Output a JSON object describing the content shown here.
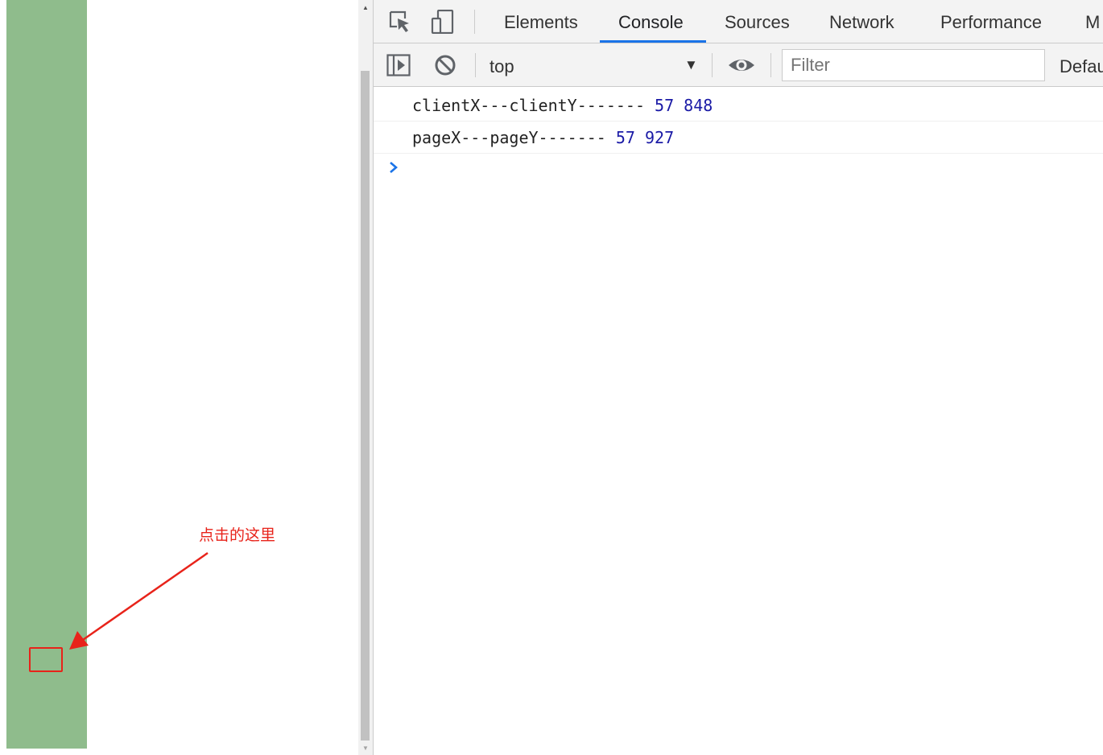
{
  "page": {
    "annotation_text": "点击的这里",
    "colors": {
      "bar": "#8fbc8c",
      "annotation": "#e8231a"
    }
  },
  "scrollbar": {
    "up_icon": "triangle-up-icon",
    "down_icon": "triangle-down-icon"
  },
  "devtools": {
    "tabs": [
      {
        "label": "Elements"
      },
      {
        "label": "Console",
        "active": true
      },
      {
        "label": "Sources"
      },
      {
        "label": "Network"
      },
      {
        "label": "Performance"
      },
      {
        "label": "M"
      }
    ],
    "toolbar": {
      "context": "top",
      "filter_placeholder": "Filter",
      "levels": "Default levels"
    },
    "console": {
      "lines": [
        {
          "text": "clientX---clientY-------",
          "values": [
            "57",
            "848"
          ]
        },
        {
          "text": "pageX---pageY-------",
          "values": [
            "57",
            "927"
          ]
        }
      ]
    },
    "colors": {
      "accent": "#1a73e8",
      "number": "#1a1aa6"
    }
  }
}
